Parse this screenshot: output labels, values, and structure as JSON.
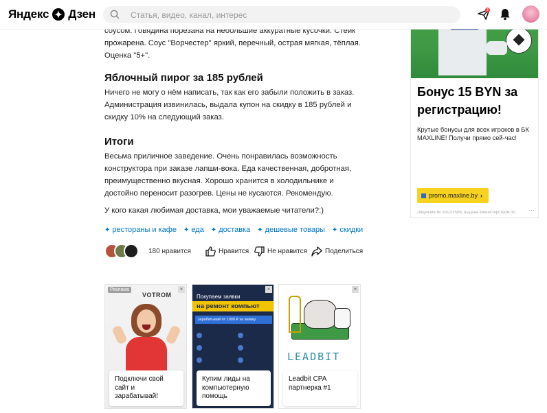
{
  "header": {
    "logo_left": "Яндекс",
    "logo_right": "Дзен",
    "search_placeholder": "Статья, видео, канал, интерес",
    "notif_count": "2"
  },
  "article": {
    "partial_p1_line1": "соусом. Говядина порезана на небольшие аккуратные кусочки. Стейк",
    "partial_p1_line2": "прожарена. Соус \"Ворчестер\" яркий, перечный, острая мягкая, тёплая.",
    "partial_p1_line3": "Оценка \"5+\".",
    "h_pie": "Яблочный пирог за 185 рублей",
    "p_pie": "Ничего не могу о нём написать, так как его забыли положить в заказ. Администрация извинилась, выдала купон на скидку в 185 рублей и скидку 10% на следующий заказ.",
    "h_summary": "Итоги",
    "p_summary": "Весьма приличное заведение. Очень понравилась возможность конструктора при заказе лапши-вока. Еда качественная, добротная, преимущественно вкусная. Хорошо хранится в холодильнике и достойно переносит разогрев. Цены не кусаются. Рекомендую.",
    "question": "У кого какая любимая доставка, мои уважаемые читатели?:)",
    "tags": [
      "рестораны и кафе",
      "еда",
      "доставка",
      "дешевые товары",
      "скидки"
    ],
    "likes_count": "180 нравится",
    "like_label": "Нравится",
    "dislike_label": "Не нравится",
    "share_label": "Поделиться"
  },
  "side_ad": {
    "title": "Бонус 15 BYN за регистрацию!",
    "text": "Крутые бонусы для всех игроков в БК MAXLINE! Получи прямо сей-час!",
    "button": "promo.maxline.by",
    "license": "Лицензия № 33120/586, выдана Министерством по"
  },
  "cards": [
    {
      "tag": "Реклама",
      "brand": "VOTROM",
      "caption": "Подключи свой сайт и зарабатывай!"
    },
    {
      "banner_line1": "Покупаем заявки",
      "banner_line2": "на ремонт компьют",
      "banner_line3": "зарабатывай от 1000 ₽ за заявку",
      "caption": "Купим лиды на компьютерную помощь"
    },
    {
      "brand": "LEADBIT",
      "caption": "Leadbit CPA партнерка #1"
    }
  ],
  "colors": {
    "accent": "#0077cc",
    "yellow": "#f7d21e",
    "green": "#3f9a45"
  }
}
